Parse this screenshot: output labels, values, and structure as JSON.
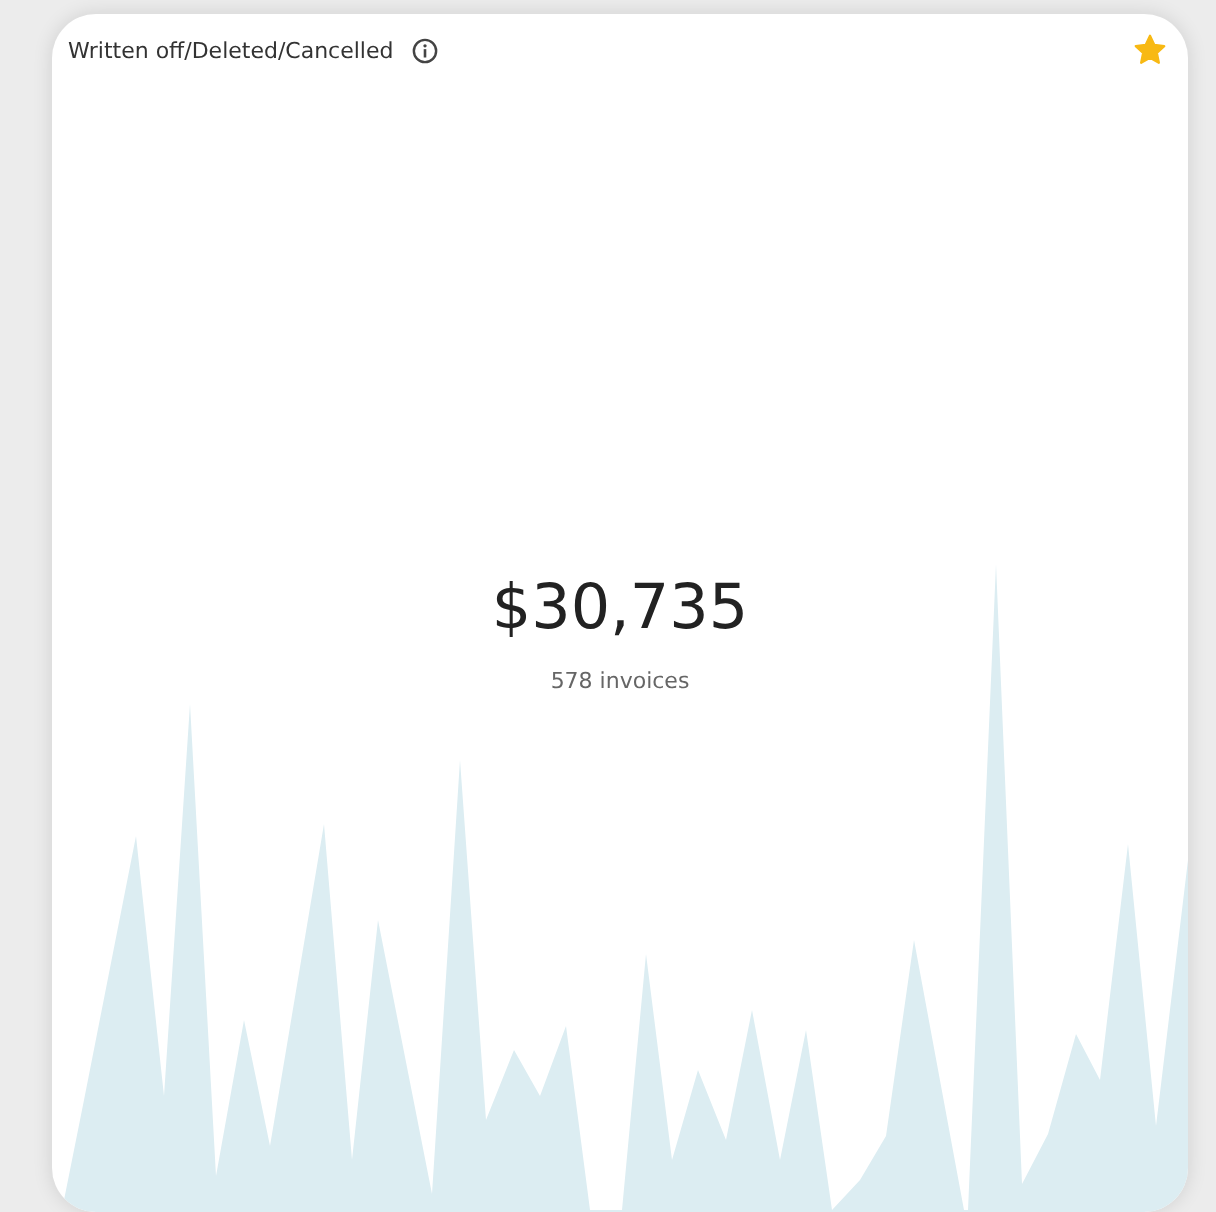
{
  "card": {
    "title": "Written off/Deleted/Cancelled",
    "starred": true,
    "amount": "$30,735",
    "subtitle": "578 invoices"
  }
}
